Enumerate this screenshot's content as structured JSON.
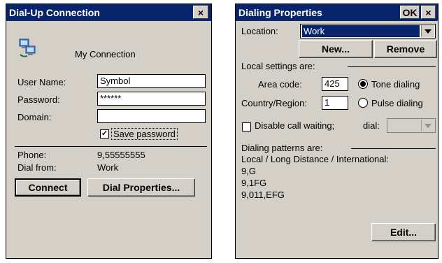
{
  "dialup": {
    "title": "Dial-Up Connection",
    "close_label": "×",
    "connection_name": "My Connection",
    "user_name_label": "User Name:",
    "user_name_value": "Symbol",
    "password_label": "Password:",
    "password_value": "******",
    "domain_label": "Domain:",
    "domain_value": "",
    "save_password_label": "Save password",
    "save_password_checked": "✓",
    "phone_label": "Phone:",
    "phone_value": "9,55555555",
    "dial_from_label": "Dial from:",
    "dial_from_value": "Work",
    "connect_label": "Connect",
    "dial_properties_label": "Dial Properties..."
  },
  "dialing": {
    "title": "Dialing Properties",
    "ok_label": "OK",
    "close_label": "×",
    "location_label": "Location:",
    "location_value": "Work",
    "new_label": "New...",
    "remove_label": "Remove",
    "local_settings_label": "Local settings are:",
    "area_code_label": "Area code:",
    "area_code_value": "425",
    "tone_label": "Tone dialing",
    "country_label": "Country/Region:",
    "country_value": "1",
    "pulse_label": "Pulse dialing",
    "disable_call_waiting_label": "Disable call waiting;",
    "dial_label": "dial:",
    "patterns_label": "Dialing patterns are:",
    "patterns_header": "Local / Long Distance / International:",
    "patterns": [
      "9,G",
      "9,1FG",
      "9,011,EFG"
    ],
    "edit_label": "Edit..."
  }
}
